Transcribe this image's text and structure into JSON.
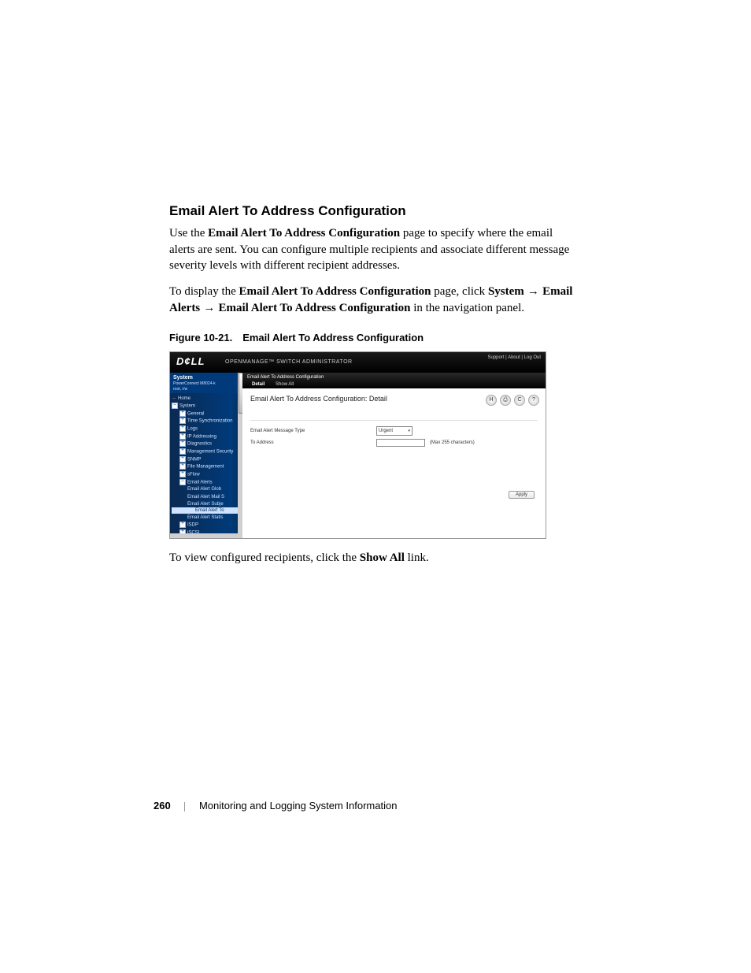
{
  "section": {
    "heading": "Email Alert To Address Configuration",
    "para1_a": "Use the ",
    "para1_b": "Email Alert To Address Configuration",
    "para1_c": " page to specify where the email alerts are sent. You can configure multiple recipients and associate different message severity levels with different recipient addresses.",
    "para2_a": "To display the ",
    "para2_b": "Email Alert To Address Configuration",
    "para2_c": " page, click ",
    "para2_d": "System",
    "para2_e": "Email Alerts",
    "para2_f": "Email Alert To Address Configuration",
    "para2_g": " in the navigation panel.",
    "figure_caption": "Figure 10-21. Email Alert To Address Configuration",
    "post_figure_a": "To view configured recipients, click the ",
    "post_figure_b": "Show All",
    "post_figure_c": " link."
  },
  "screenshot": {
    "logo": "D¢LL",
    "header_title": "OPENMANAGE™ SWITCH ADMINISTRATOR",
    "header_links": "Support | About | Log Out",
    "sidebar": {
      "title": "System",
      "device": "PowerConnect M8024-k",
      "user": "root, r/w",
      "nodes": {
        "home": "Home",
        "system": "System",
        "general": "General",
        "timesync": "Time Synchronization",
        "logs": "Logs",
        "ipaddr": "IP Addressing",
        "diag": "Diagnostics",
        "mgmtsec": "Management Security",
        "snmp": "SNMP",
        "filemgmt": "File Management",
        "sflow": "sFlow",
        "emailalerts": "Email Alerts",
        "ea_global": "Email Alert Glob",
        "ea_mail": "Email Alert Mail S",
        "ea_subj": "Email Alert Subje",
        "ea_to": "Email Alert To",
        "ea_stats": "Email Alert Statis",
        "isdp": "ISDP",
        "iscsi": "iSCSI"
      }
    },
    "main": {
      "crumb": "Email Alert To Address Configuration",
      "tab_detail": "Detail",
      "tab_showall": "Show All",
      "panel_title": "Email Alert To Address Configuration: Detail",
      "row1_label": "Email Alert Message Type",
      "row1_value": "Urgent",
      "row2_label": "To Address",
      "row2_hint": "(Max 255 characters)",
      "apply": "Apply"
    },
    "icons": {
      "save": "H",
      "print": "⎙",
      "refresh": "C",
      "help": "?"
    }
  },
  "footer": {
    "page_number": "260",
    "title": "Monitoring and Logging System Information"
  }
}
